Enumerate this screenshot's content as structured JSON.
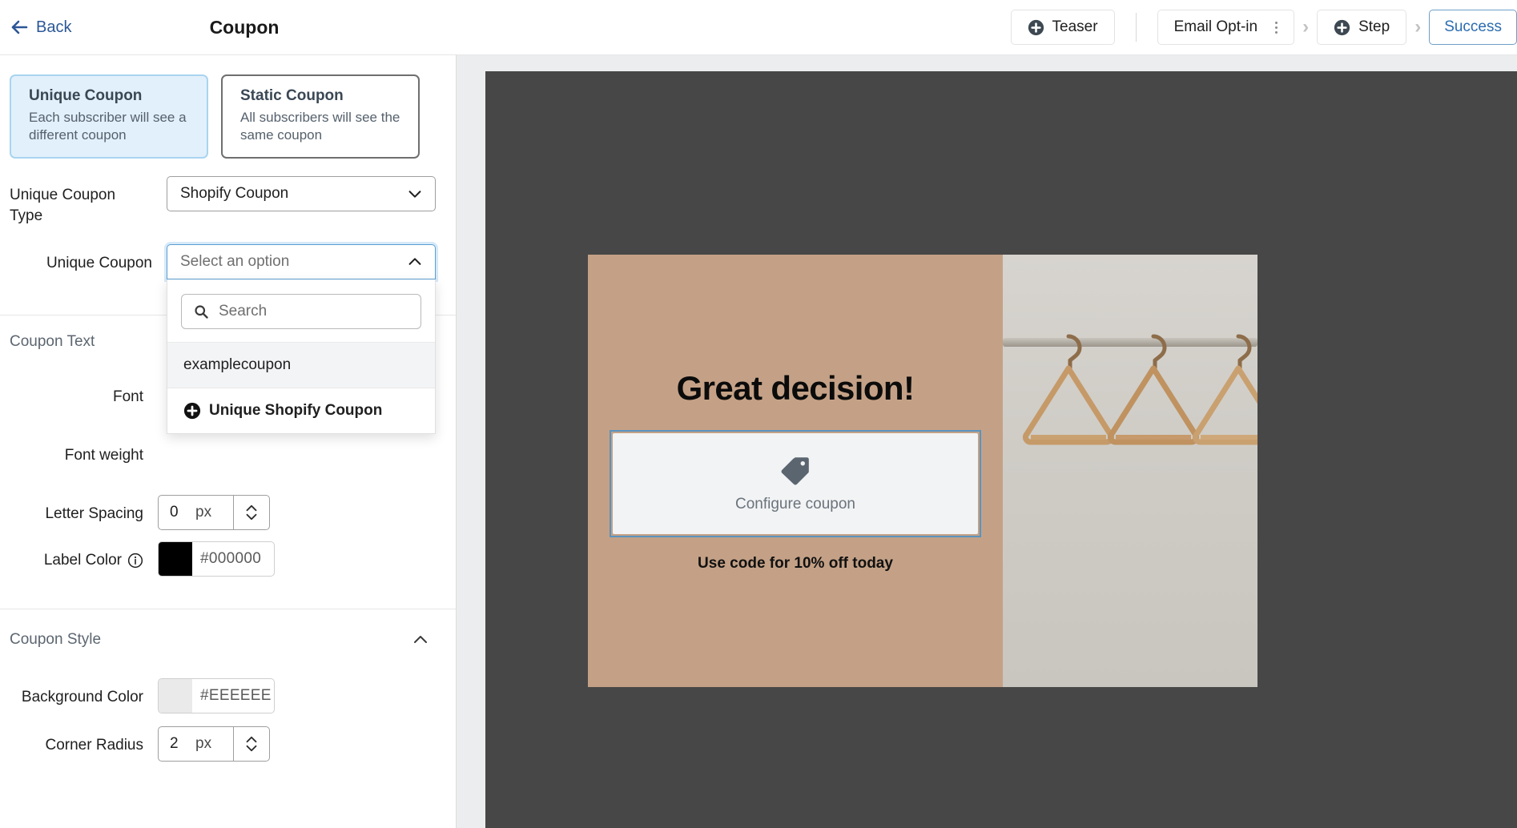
{
  "topbar": {
    "back_label": "Back",
    "back_icon": "arrow-left-icon",
    "title": "Coupon",
    "teaser_label": "Teaser",
    "email_optin_label": "Email Opt-in",
    "step_label": "Step",
    "success_label": "Success",
    "chevron": "›"
  },
  "coupon_types": [
    {
      "title": "Unique Coupon",
      "subtitle": "Each subscriber will see a different coupon",
      "selected": true
    },
    {
      "title": "Static Coupon",
      "subtitle": "All subscribers will see the same coupon",
      "selected": false
    }
  ],
  "fields": {
    "unique_coupon_type_label": "Unique Coupon Type",
    "unique_coupon_type_value": "Shopify Coupon",
    "unique_coupon_label": "Unique Coupon",
    "unique_coupon_placeholder": "Select an option"
  },
  "dropdown": {
    "search_placeholder": "Search",
    "search_value": "",
    "search_icon": "search-icon",
    "options": [
      {
        "label": "examplecoupon",
        "highlighted": true
      },
      {
        "label": "Unique Shopify Coupon",
        "action": true,
        "icon": "plus-circle-icon"
      }
    ]
  },
  "coupon_text_section": {
    "title": "Coupon Text",
    "font_label": "Font",
    "font_weight_label": "Font weight",
    "letter_spacing_label": "Letter Spacing",
    "letter_spacing_value": "0",
    "letter_spacing_unit": "px",
    "label_color_label": "Label Color",
    "label_color_info_icon": "info-icon",
    "label_color_value": "#000000",
    "label_color_swatch": "#000000"
  },
  "coupon_style_section": {
    "title": "Coupon Style",
    "collapse_icon": "chevron-up-icon",
    "background_color_label": "Background Color",
    "background_color_value": "#EEEEEE",
    "background_color_swatch": "#EEEEEE",
    "corner_radius_label": "Corner Radius",
    "corner_radius_value": "2",
    "corner_radius_unit": "px"
  },
  "preview": {
    "headline": "Great decision!",
    "coupon_cta": "Configure coupon",
    "coupon_icon": "tag-icon",
    "use_code_text": "Use code for 10% off today",
    "background_color": "#474747",
    "popup_background": "#C4A186",
    "coupon_box_color": "#F2F3F4",
    "selection_outline_color": "#5A93BF"
  }
}
